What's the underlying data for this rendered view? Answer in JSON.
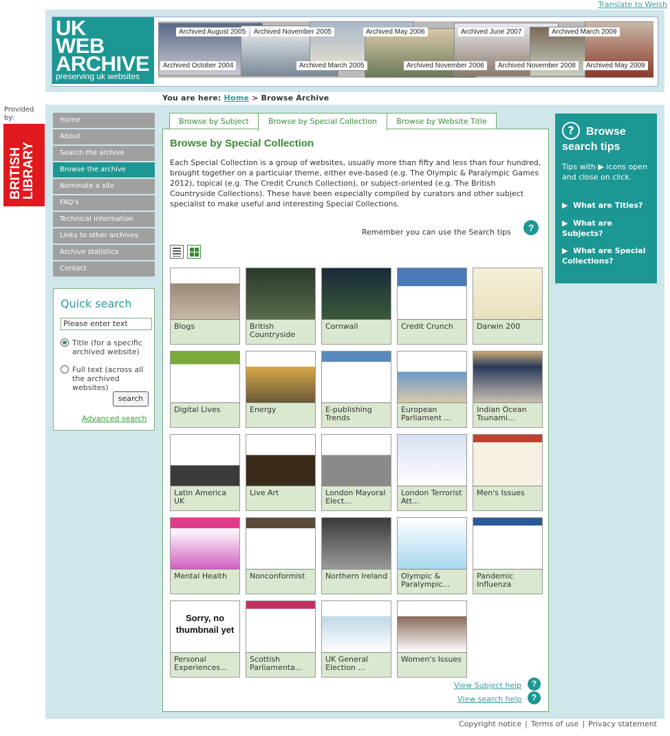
{
  "translate": "Translate to Welsh",
  "logo": {
    "line1": "UK",
    "line2": "WEB",
    "line3": "ARCHIVE",
    "tagline": "preserving uk websites"
  },
  "archive_labels": [
    "Archived August 2005",
    "Archived November 2005",
    "Archived May 2006",
    "Archived June 2007",
    "Archived March 2009",
    "Archived October 2004",
    "Archived March 2005",
    "Archived November 2006",
    "Archived November 2008",
    "Archived May 2009"
  ],
  "breadcrumb": {
    "prefix": "You are here:",
    "home": "Home",
    "sep": ">",
    "current": "Browse Archive"
  },
  "provided_by": "Provided by:",
  "british_library": "BRITISH LIBRARY",
  "nav": [
    "Home",
    "About",
    "Search the archive",
    "Browse the archive",
    "Nominate a site",
    "FAQ's",
    "Technical information",
    "Links to other archives",
    "Archive statistics",
    "Contact"
  ],
  "quick_search": {
    "title": "Quick search",
    "placeholder": "Please enter text",
    "option_title": "Title (for a specific archived website)",
    "option_full": "Full text (across all the archived websites)",
    "button": "search",
    "advanced": "Advanced search"
  },
  "tabs": [
    "Browse by Subject",
    "Browse by Special Collection",
    "Browse by Website Title"
  ],
  "content": {
    "title": "Browse by Special Collection",
    "description": "Each Special Collection is a group of websites, usually more than fifty and less than four hundred, brought together on a particular theme, either eve-based (e.g. The Olympic & Paralympic Games 2012), topical (e.g. The Credit Crunch Collection), or subject-oriented (e.g. The British Countryside Collections). These have been especially compiled by curators and other subject specialist to make useful and interesting Special Collections.",
    "remember": "Remember you can use the Search tips",
    "no_thumb": "Sorry, no thumbnail yet"
  },
  "collections": [
    "Blogs",
    "British Countryside",
    "Cornwall",
    "Credit Crunch",
    "Darwin 200",
    "Digital Lives",
    "Energy",
    "E-publishing Trends",
    "European Parliament ...",
    "Indian Ocean Tsunami...",
    "Latin America UK",
    "Live Art",
    "London Mayoral Elect...",
    "London Terrorist Att...",
    "Men's Issues",
    "Mental Health",
    "Nonconformist",
    "Northern Ireland",
    "Olympic & Paralympic...",
    "Pandemic Influenza",
    "Personal Experiences...",
    "Scottish Parliamenta...",
    "UK General Election ...",
    "Women's Issues"
  ],
  "help_links": {
    "subject": "View Subject help",
    "search": "View search help"
  },
  "tips": {
    "title_line1": "Browse",
    "title_line2": "search tips",
    "body": "Tips with ▶ icons open and close on click.",
    "links": [
      "What are Titles?",
      "What are Subjects?",
      "What are Special Collections?"
    ]
  },
  "footer": [
    "Copyright notice",
    "Terms of use",
    "Privacy statement"
  ],
  "colors": {
    "teal": "#1d9793",
    "band": "#cfe7ea",
    "green_text": "#3a8a3a",
    "card_bg": "#d9e8cf",
    "library_red": "#e0191e"
  }
}
